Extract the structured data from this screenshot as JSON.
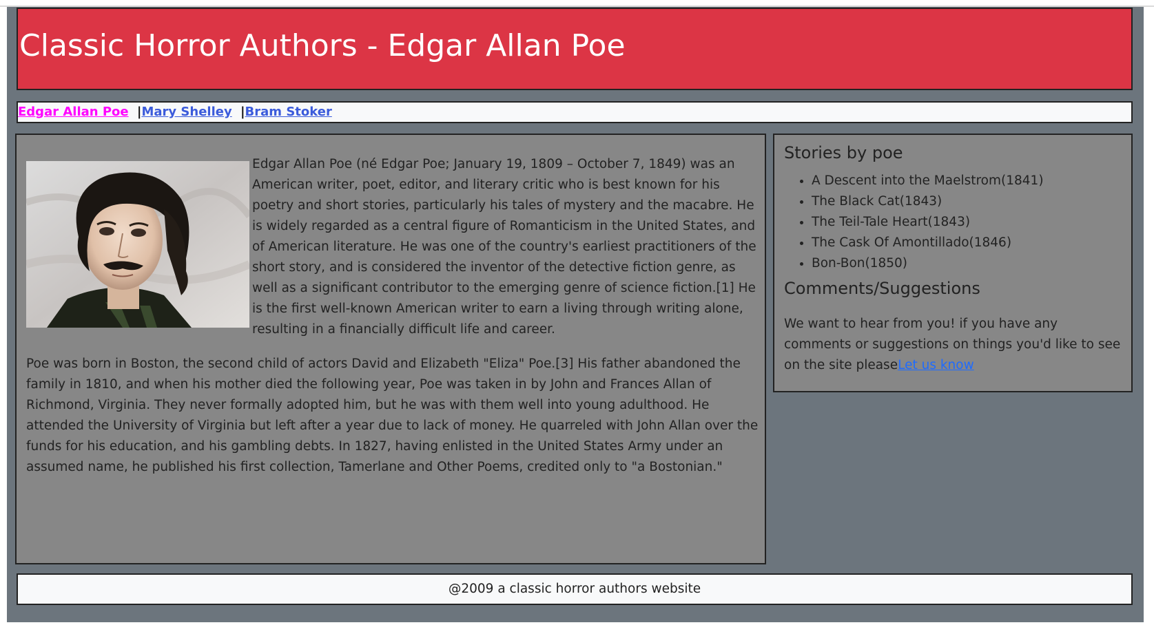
{
  "header": {
    "title": "Classic Horror Authors - Edgar Allan Poe"
  },
  "nav": {
    "items": [
      {
        "label": "Edgar Allan Poe"
      },
      {
        "label": "Mary Shelley"
      },
      {
        "label": "Bram Stoker"
      }
    ],
    "separator": "|"
  },
  "main": {
    "portrait_icon": "portrait-image",
    "bio_paragraph_1": "Edgar Allan Poe (né Edgar Poe; January 19, 1809 – October 7, 1849) was an American writer, poet, editor, and literary critic who is best known for his poetry and short stories, particularly his tales of mystery and the macabre. He is widely regarded as a central figure of Romanticism in the United States, and of American literature. He was one of the country's earliest practitioners of the short story, and is considered the inventor of the detective fiction genre, as well as a significant contributor to the emerging genre of science fiction.[1] He is the first well-known American writer to earn a living through writing alone, resulting in a financially difficult life and career.",
    "bio_paragraph_2": "Poe was born in Boston, the second child of actors David and Elizabeth \"Eliza\" Poe.[3] His father abandoned the family in 1810, and when his mother died the following year, Poe was taken in by John and Frances Allan of Richmond, Virginia. They never formally adopted him, but he was with them well into young adulthood. He attended the University of Virginia but left after a year due to lack of money. He quarreled with John Allan over the funds for his education, and his gambling debts. In 1827, having enlisted in the United States Army under an assumed name, he published his first collection, Tamerlane and Other Poems, credited only to \"a Bostonian.\""
  },
  "aside": {
    "stories_title": "Stories by poe",
    "stories": [
      "A Descent into the Maelstrom(1841)",
      "The Black Cat(1843)",
      "The Teil-Tale Heart(1843)",
      "The Cask Of Amontillado(1846)",
      "Bon-Bon(1850)"
    ],
    "comments_title": "Comments/Suggestions",
    "comments_text": "We want to hear from you! if you have any comments or suggestions on things you'd like to see on the site please",
    "comments_link": "Let us know"
  },
  "footer": {
    "text": "@2009 a classic horror authors website"
  },
  "colors": {
    "header_bg": "#dc3545",
    "page_bg": "#6c757d",
    "content_bg": "#878787",
    "nav_bg": "#f8f9fa",
    "link": "#3b5bdb",
    "active_link": "#ff00ff",
    "aside_link": "#1e6bff"
  }
}
